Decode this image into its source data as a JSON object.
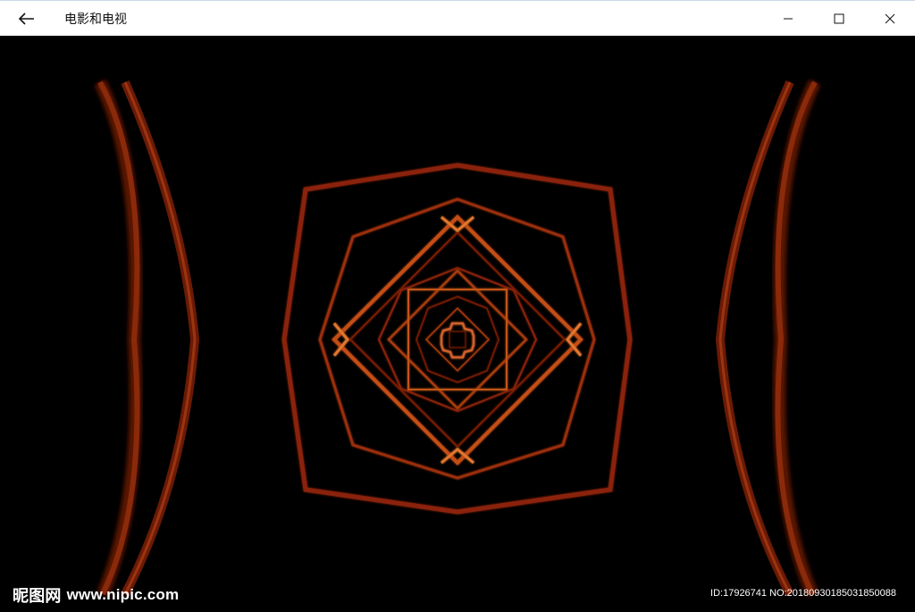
{
  "window": {
    "title": "电影和电视",
    "controls": {
      "back": "back-arrow-icon",
      "minimize": "minimize-icon",
      "maximize": "maximize-icon",
      "close": "close-icon"
    }
  },
  "video": {
    "colors": {
      "background": "#000000",
      "stroke_dark": "#7a1e06",
      "stroke_mid": "#b5400f",
      "stroke_bright": "#e2762d"
    }
  },
  "watermark": {
    "logo_cn": "昵图网",
    "logo_url": "www.nipic.com",
    "id_text": "ID:17926741 NO:20180930185031850088"
  }
}
